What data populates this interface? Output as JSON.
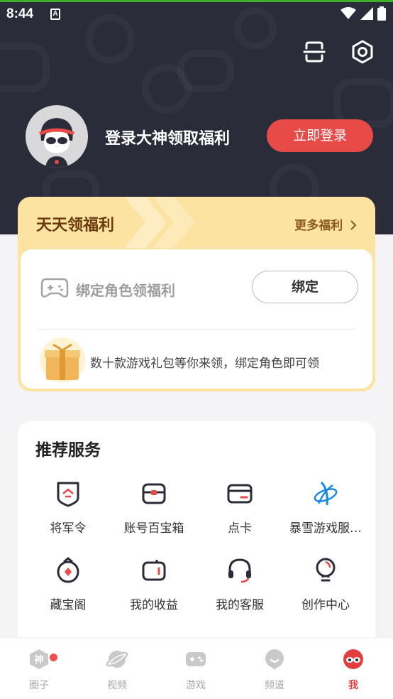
{
  "status_bar": {
    "time": "8:44",
    "notif_letter": "A"
  },
  "header": {
    "login_prompt": "登录大神领取福利",
    "login_button": "立即登录"
  },
  "welfare": {
    "title": "天天领福利",
    "more": "更多福利",
    "bind_label": "绑定角色领福利",
    "bind_button": "绑定",
    "gift_text": "数十款游戏礼包等你来领，绑定角色即可领"
  },
  "services": {
    "title": "推荐服务",
    "items": [
      {
        "label": "将军令",
        "icon": "token-shield-icon"
      },
      {
        "label": "账号百宝箱",
        "icon": "treasure-box-icon"
      },
      {
        "label": "点卡",
        "icon": "point-card-icon"
      },
      {
        "label": "暴雪游戏服…",
        "icon": "blizzard-icon"
      },
      {
        "label": "藏宝阁",
        "icon": "treasure-pavilion-icon"
      },
      {
        "label": "我的收益",
        "icon": "wallet-icon"
      },
      {
        "label": "我的客服",
        "icon": "headset-icon"
      },
      {
        "label": "创作中心",
        "icon": "lightbulb-icon"
      }
    ]
  },
  "bottom_nav": {
    "items": [
      {
        "label": "圈子",
        "icon": "circle-shen-icon"
      },
      {
        "label": "视频",
        "icon": "planet-icon"
      },
      {
        "label": "游戏",
        "icon": "gamepad-icon"
      },
      {
        "label": "频道",
        "icon": "channel-icon"
      },
      {
        "label": "我",
        "icon": "me-mask-icon"
      }
    ],
    "active": "我"
  },
  "colors": {
    "header_bg": "#2b2c3a",
    "accent_red": "#e84a48",
    "welfare_bg": "#fde3a2",
    "nav_active": "#e23e3e"
  }
}
